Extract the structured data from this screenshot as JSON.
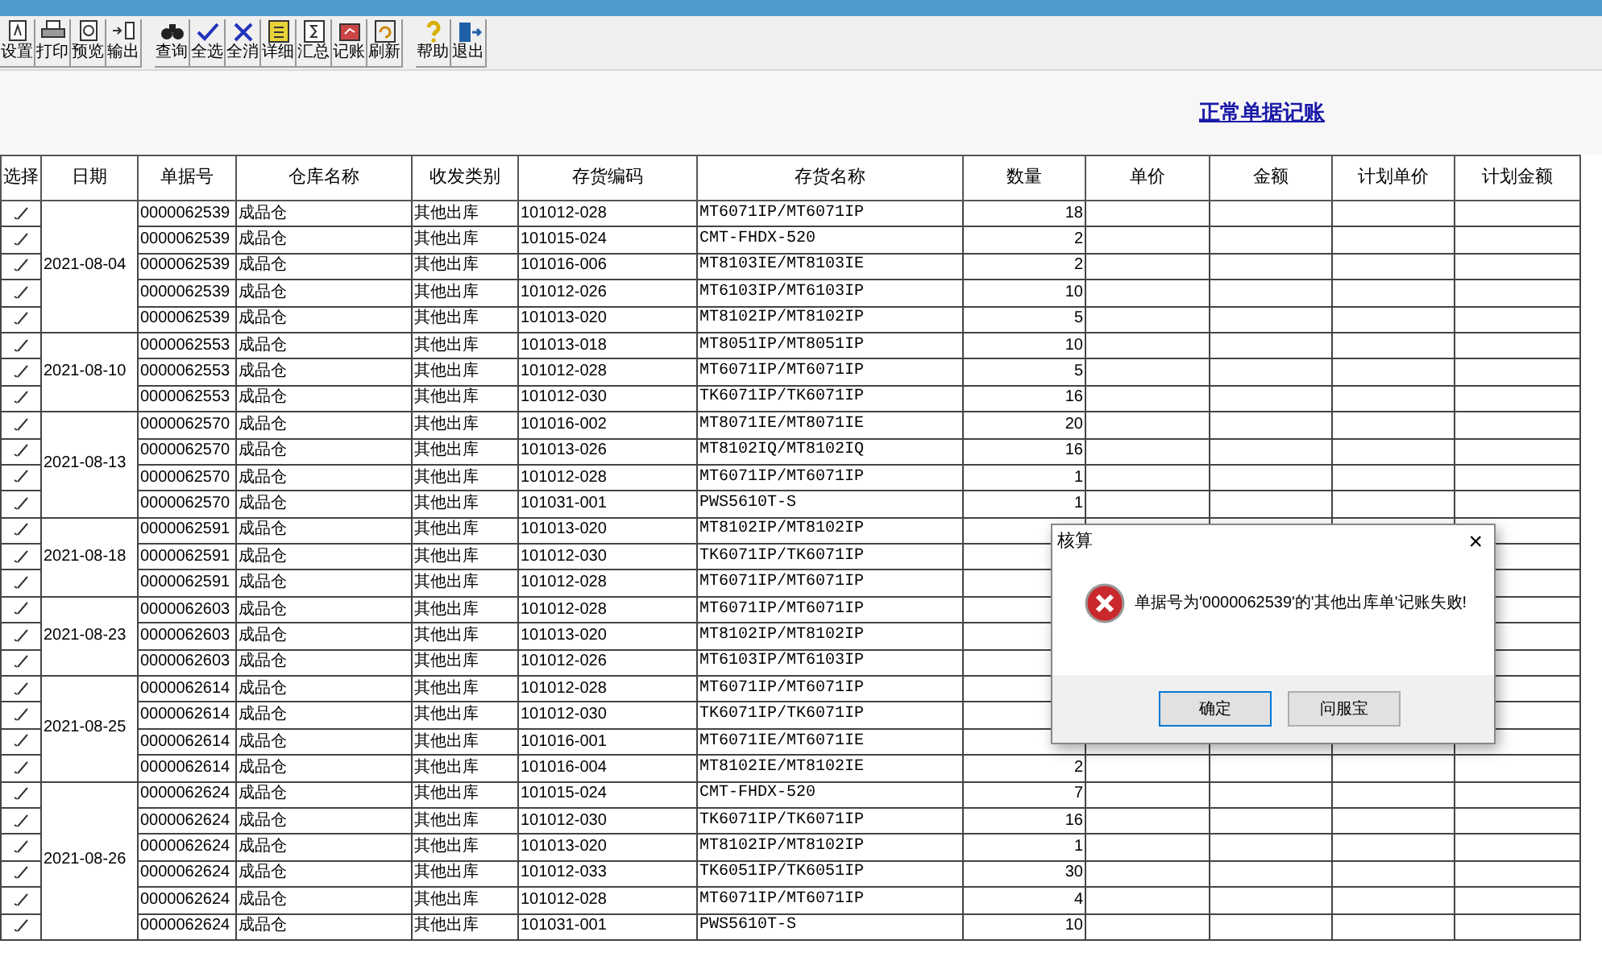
{
  "toolbar": [
    [
      {
        "label": "设置"
      },
      {
        "label": "打印"
      },
      {
        "label": "预览"
      },
      {
        "label": "输出"
      }
    ],
    [
      {
        "label": "查询"
      },
      {
        "label": "全选"
      },
      {
        "label": "全消"
      },
      {
        "label": "详细"
      },
      {
        "label": "汇总"
      },
      {
        "label": "记账"
      },
      {
        "label": "刷新"
      }
    ],
    [
      {
        "label": "帮助"
      },
      {
        "label": "退出"
      }
    ]
  ],
  "title": "正常单据记账",
  "table": {
    "columns": [
      "选择",
      "日期",
      "单据号",
      "仓库名称",
      "收发类别",
      "存货编码",
      "存货名称",
      "数量",
      "单价",
      "金额",
      "计划单价",
      "计划金额"
    ],
    "groups": [
      {
        "date": "2021-08-04",
        "rows": [
          {
            "selected": true,
            "doc": "0000062539",
            "warehouse": "成品仓",
            "type": "其他出库",
            "code": "101012-028",
            "name": "MT6071IP/MT6071IP",
            "qty": "18"
          },
          {
            "selected": true,
            "doc": "0000062539",
            "warehouse": "成品仓",
            "type": "其他出库",
            "code": "101015-024",
            "name": "CMT-FHDX-520",
            "qty": "2"
          },
          {
            "selected": true,
            "doc": "0000062539",
            "warehouse": "成品仓",
            "type": "其他出库",
            "code": "101016-006",
            "name": "MT8103IE/MT8103IE",
            "qty": "2"
          },
          {
            "selected": true,
            "doc": "0000062539",
            "warehouse": "成品仓",
            "type": "其他出库",
            "code": "101012-026",
            "name": "MT6103IP/MT6103IP",
            "qty": "10"
          },
          {
            "selected": true,
            "doc": "0000062539",
            "warehouse": "成品仓",
            "type": "其他出库",
            "code": "101013-020",
            "name": "MT8102IP/MT8102IP",
            "qty": "5"
          }
        ]
      },
      {
        "date": "2021-08-10",
        "rows": [
          {
            "selected": true,
            "doc": "0000062553",
            "warehouse": "成品仓",
            "type": "其他出库",
            "code": "101013-018",
            "name": "MT8051IP/MT8051IP",
            "qty": "10"
          },
          {
            "selected": true,
            "doc": "0000062553",
            "warehouse": "成品仓",
            "type": "其他出库",
            "code": "101012-028",
            "name": "MT6071IP/MT6071IP",
            "qty": "5"
          },
          {
            "selected": true,
            "doc": "0000062553",
            "warehouse": "成品仓",
            "type": "其他出库",
            "code": "101012-030",
            "name": "TK6071IP/TK6071IP",
            "qty": "16"
          }
        ]
      },
      {
        "date": "2021-08-13",
        "rows": [
          {
            "selected": true,
            "doc": "0000062570",
            "warehouse": "成品仓",
            "type": "其他出库",
            "code": "101016-002",
            "name": "MT8071IE/MT8071IE",
            "qty": "20"
          },
          {
            "selected": true,
            "doc": "0000062570",
            "warehouse": "成品仓",
            "type": "其他出库",
            "code": "101013-026",
            "name": "MT8102IQ/MT8102IQ",
            "qty": "16"
          },
          {
            "selected": true,
            "doc": "0000062570",
            "warehouse": "成品仓",
            "type": "其他出库",
            "code": "101012-028",
            "name": "MT6071IP/MT6071IP",
            "qty": "1"
          },
          {
            "selected": true,
            "doc": "0000062570",
            "warehouse": "成品仓",
            "type": "其他出库",
            "code": "101031-001",
            "name": "PWS5610T-S",
            "qty": "1"
          }
        ]
      },
      {
        "date": "2021-08-18",
        "rows": [
          {
            "selected": true,
            "doc": "0000062591",
            "warehouse": "成品仓",
            "type": "其他出库",
            "code": "101013-020",
            "name": "MT8102IP/MT8102IP"
          },
          {
            "selected": true,
            "doc": "0000062591",
            "warehouse": "成品仓",
            "type": "其他出库",
            "code": "101012-030",
            "name": "TK6071IP/TK6071IP"
          },
          {
            "selected": true,
            "doc": "0000062591",
            "warehouse": "成品仓",
            "type": "其他出库",
            "code": "101012-028",
            "name": "MT6071IP/MT6071IP"
          }
        ]
      },
      {
        "date": "2021-08-23",
        "rows": [
          {
            "selected": true,
            "doc": "0000062603",
            "warehouse": "成品仓",
            "type": "其他出库",
            "code": "101012-028",
            "name": "MT6071IP/MT6071IP"
          },
          {
            "selected": true,
            "doc": "0000062603",
            "warehouse": "成品仓",
            "type": "其他出库",
            "code": "101013-020",
            "name": "MT8102IP/MT8102IP"
          },
          {
            "selected": true,
            "doc": "0000062603",
            "warehouse": "成品仓",
            "type": "其他出库",
            "code": "101012-026",
            "name": "MT6103IP/MT6103IP"
          }
        ]
      },
      {
        "date": "2021-08-25",
        "rows": [
          {
            "selected": true,
            "doc": "0000062614",
            "warehouse": "成品仓",
            "type": "其他出库",
            "code": "101012-028",
            "name": "MT6071IP/MT6071IP"
          },
          {
            "selected": true,
            "doc": "0000062614",
            "warehouse": "成品仓",
            "type": "其他出库",
            "code": "101012-030",
            "name": "TK6071IP/TK6071IP"
          },
          {
            "selected": true,
            "doc": "0000062614",
            "warehouse": "成品仓",
            "type": "其他出库",
            "code": "101016-001",
            "name": "MT6071IE/MT6071IE"
          },
          {
            "selected": true,
            "doc": "0000062614",
            "warehouse": "成品仓",
            "type": "其他出库",
            "code": "101016-004",
            "name": "MT8102IE/MT8102IE",
            "qty": "2"
          }
        ]
      },
      {
        "date": "2021-08-26",
        "rows": [
          {
            "selected": true,
            "doc": "0000062624",
            "warehouse": "成品仓",
            "type": "其他出库",
            "code": "101015-024",
            "name": "CMT-FHDX-520",
            "qty": "7"
          },
          {
            "selected": true,
            "doc": "0000062624",
            "warehouse": "成品仓",
            "type": "其他出库",
            "code": "101012-030",
            "name": "TK6071IP/TK6071IP",
            "qty": "16"
          },
          {
            "selected": true,
            "doc": "0000062624",
            "warehouse": "成品仓",
            "type": "其他出库",
            "code": "101013-020",
            "name": "MT8102IP/MT8102IP",
            "qty": "1"
          },
          {
            "selected": true,
            "doc": "0000062624",
            "warehouse": "成品仓",
            "type": "其他出库",
            "code": "101012-033",
            "name": "TK6051IP/TK6051IP",
            "qty": "30"
          },
          {
            "selected": true,
            "doc": "0000062624",
            "warehouse": "成品仓",
            "type": "其他出库",
            "code": "101012-028",
            "name": "MT6071IP/MT6071IP",
            "qty": "4"
          },
          {
            "selected": true,
            "doc": "0000062624",
            "warehouse": "成品仓",
            "type": "其他出库",
            "code": "101031-001",
            "name": "PWS5610T-S",
            "qty": "10"
          }
        ]
      }
    ]
  },
  "dialog": {
    "title": "核算",
    "close": "×",
    "message": "单据号为'0000062539'的'其他出库单'记账失败!",
    "buttons": [
      "确定",
      "问服宝"
    ]
  }
}
